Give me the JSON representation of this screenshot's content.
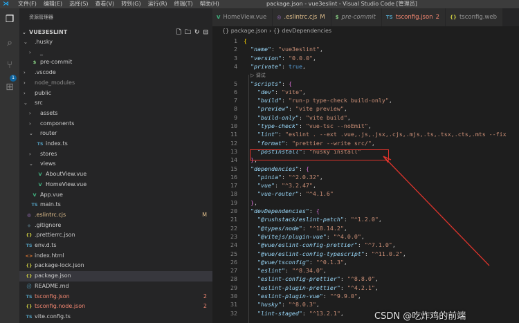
{
  "titlebar": {
    "menus": [
      "文件(F)",
      "编辑(E)",
      "选择(S)",
      "查看(V)",
      "转到(G)",
      "运行(R)",
      "终端(T)",
      "帮助(H)"
    ],
    "window_title": "package.json - vue3eslint - Visual Studio Code [管理员]"
  },
  "activity": {
    "scm_badge": "1"
  },
  "sidebar": {
    "title": "资源管理器",
    "folder": "VUE3ESLINT",
    "rows": [
      {
        "name": ".husky",
        "depth": 1,
        "kind": "folder",
        "open": true
      },
      {
        "name": "_",
        "depth": 2,
        "kind": "folder",
        "open": false
      },
      {
        "name": "pre-commit",
        "depth": 2,
        "kind": "file",
        "icon": "$",
        "iconColor": "#89d185"
      },
      {
        "name": ".vscode",
        "depth": 1,
        "kind": "folder",
        "open": false
      },
      {
        "name": "node_modules",
        "depth": 1,
        "kind": "folder",
        "open": false,
        "dim": true
      },
      {
        "name": "public",
        "depth": 1,
        "kind": "folder",
        "open": false
      },
      {
        "name": "src",
        "depth": 1,
        "kind": "folder",
        "open": true
      },
      {
        "name": "assets",
        "depth": 2,
        "kind": "folder",
        "open": false
      },
      {
        "name": "components",
        "depth": 2,
        "kind": "folder",
        "open": false
      },
      {
        "name": "router",
        "depth": 2,
        "kind": "folder",
        "open": true
      },
      {
        "name": "index.ts",
        "depth": 3,
        "kind": "file",
        "icon": "TS",
        "iconColor": "#519aba"
      },
      {
        "name": "stores",
        "depth": 2,
        "kind": "folder",
        "open": false
      },
      {
        "name": "views",
        "depth": 2,
        "kind": "folder",
        "open": true
      },
      {
        "name": "AboutView.vue",
        "depth": 3,
        "kind": "file",
        "icon": "V",
        "iconColor": "#41b883"
      },
      {
        "name": "HomeView.vue",
        "depth": 3,
        "kind": "file",
        "icon": "V",
        "iconColor": "#41b883"
      },
      {
        "name": "App.vue",
        "depth": 2,
        "kind": "file",
        "icon": "V",
        "iconColor": "#41b883"
      },
      {
        "name": "main.ts",
        "depth": 2,
        "kind": "file",
        "icon": "TS",
        "iconColor": "#519aba"
      },
      {
        "name": ".eslintrc.cjs",
        "depth": 1,
        "kind": "file",
        "icon": "◎",
        "iconColor": "#a074c4",
        "badge": "M",
        "color": "#e2c08d"
      },
      {
        "name": ".gitignore",
        "depth": 1,
        "kind": "file",
        "icon": "◆",
        "iconColor": "#41535b"
      },
      {
        "name": ".prettierrc.json",
        "depth": 1,
        "kind": "file",
        "icon": "{}",
        "iconColor": "#cbcb41"
      },
      {
        "name": "env.d.ts",
        "depth": 1,
        "kind": "file",
        "icon": "TS",
        "iconColor": "#519aba"
      },
      {
        "name": "index.html",
        "depth": 1,
        "kind": "file",
        "icon": "<>",
        "iconColor": "#e37933"
      },
      {
        "name": "package-lock.json",
        "depth": 1,
        "kind": "file",
        "icon": "{}",
        "iconColor": "#cbcb41"
      },
      {
        "name": "package.json",
        "depth": 1,
        "kind": "file",
        "icon": "{}",
        "iconColor": "#cbcb41",
        "selected": true
      },
      {
        "name": "README.md",
        "depth": 1,
        "kind": "file",
        "icon": "ⓘ",
        "iconColor": "#519aba"
      },
      {
        "name": "tsconfig.json",
        "depth": 1,
        "kind": "file",
        "icon": "TS",
        "iconColor": "#519aba",
        "badge": "2",
        "color": "#f48771"
      },
      {
        "name": "tsconfig.node.json",
        "depth": 1,
        "kind": "file",
        "icon": "{}",
        "iconColor": "#cbcb41",
        "badge": "2",
        "color": "#f48771"
      },
      {
        "name": "vite.config.ts",
        "depth": 1,
        "kind": "file",
        "icon": "TS",
        "iconColor": "#519aba"
      }
    ]
  },
  "tabs": [
    {
      "label": "HomeView.vue",
      "icon": "V",
      "iconColor": "#41b883",
      "color": "#969696"
    },
    {
      "label": ".eslintrc.cjs",
      "icon": "◎",
      "iconColor": "#a074c4",
      "suffix": "M",
      "color": "#e2c08d"
    },
    {
      "label": "pre-commit",
      "icon": "$",
      "iconColor": "#89d185",
      "color": "#969696",
      "italic": true
    },
    {
      "label": "tsconfig.json",
      "icon": "TS",
      "iconColor": "#519aba",
      "suffix": "2",
      "color": "#f48771"
    },
    {
      "label": "tsconfig.web",
      "icon": "{}",
      "iconColor": "#cbcb41",
      "color": "#969696"
    }
  ],
  "breadcrumb": [
    "{} package.json",
    "{} devDependencies"
  ],
  "code": [
    {
      "n": "1",
      "t": [
        [
          "br",
          "{"
        ]
      ]
    },
    {
      "n": "2",
      "t": [
        [
          "",
          "  "
        ],
        [
          "k",
          "\"name\""
        ],
        [
          "",
          ": "
        ],
        [
          "s",
          "\"vue3eslint\""
        ],
        [
          "",
          ","
        ]
      ]
    },
    {
      "n": "3",
      "t": [
        [
          "",
          "  "
        ],
        [
          "k",
          "\"version\""
        ],
        [
          "",
          ": "
        ],
        [
          "s",
          "\"0.0.0\""
        ],
        [
          "",
          ","
        ]
      ]
    },
    {
      "n": "4",
      "t": [
        [
          "",
          "  "
        ],
        [
          "k",
          "\"private\""
        ],
        [
          "",
          ": "
        ],
        [
          "b",
          "true"
        ],
        [
          "",
          ","
        ]
      ]
    },
    {
      "n": "",
      "lens": "▷ 调试"
    },
    {
      "n": "5",
      "t": [
        [
          "",
          "  "
        ],
        [
          "k",
          "\"scripts\""
        ],
        [
          "",
          ": "
        ],
        [
          "br2",
          "{"
        ]
      ]
    },
    {
      "n": "6",
      "t": [
        [
          "",
          "    "
        ],
        [
          "k",
          "\"dev\""
        ],
        [
          "",
          ": "
        ],
        [
          "s",
          "\"vite\""
        ],
        [
          "",
          ","
        ]
      ]
    },
    {
      "n": "7",
      "t": [
        [
          "",
          "    "
        ],
        [
          "k",
          "\"build\""
        ],
        [
          "",
          ": "
        ],
        [
          "s",
          "\"run-p type-check build-only\""
        ],
        [
          "",
          ","
        ]
      ]
    },
    {
      "n": "8",
      "t": [
        [
          "",
          "    "
        ],
        [
          "k",
          "\"preview\""
        ],
        [
          "",
          ": "
        ],
        [
          "s",
          "\"vite preview\""
        ],
        [
          "",
          ","
        ]
      ]
    },
    {
      "n": "9",
      "t": [
        [
          "",
          "    "
        ],
        [
          "k",
          "\"build-only\""
        ],
        [
          "",
          ": "
        ],
        [
          "s",
          "\"vite build\""
        ],
        [
          "",
          ","
        ]
      ]
    },
    {
      "n": "10",
      "t": [
        [
          "",
          "    "
        ],
        [
          "k",
          "\"type-check\""
        ],
        [
          "",
          ": "
        ],
        [
          "s",
          "\"vue-tsc --noEmit\""
        ],
        [
          "",
          ","
        ]
      ]
    },
    {
      "n": "11",
      "t": [
        [
          "",
          "    "
        ],
        [
          "k",
          "\"lint\""
        ],
        [
          "",
          ": "
        ],
        [
          "s",
          "\"eslint . --ext .vue,.js,.jsx,.cjs,.mjs,.ts,.tsx,.cts,.mts --fix"
        ]
      ]
    },
    {
      "n": "12",
      "t": [
        [
          "",
          "    "
        ],
        [
          "k",
          "\"format\""
        ],
        [
          "",
          ": "
        ],
        [
          "s",
          "\"prettier --write src/\""
        ],
        [
          "",
          ","
        ]
      ]
    },
    {
      "n": "13",
      "t": [
        [
          "",
          "    "
        ],
        [
          "k",
          "\"postinstall\""
        ],
        [
          "",
          ": "
        ],
        [
          "s",
          "\"husky install\""
        ]
      ]
    },
    {
      "n": "14",
      "t": [
        [
          "",
          "  "
        ],
        [
          "br2",
          "}"
        ],
        [
          "",
          ","
        ]
      ]
    },
    {
      "n": "15",
      "t": [
        [
          "",
          "  "
        ],
        [
          "k",
          "\"dependencies\""
        ],
        [
          "",
          ": "
        ],
        [
          "br2",
          "{"
        ]
      ]
    },
    {
      "n": "16",
      "t": [
        [
          "",
          "    "
        ],
        [
          "k",
          "\"pinia\""
        ],
        [
          "",
          ": "
        ],
        [
          "s",
          "\"^2.0.32\""
        ],
        [
          "",
          ","
        ]
      ]
    },
    {
      "n": "17",
      "t": [
        [
          "",
          "    "
        ],
        [
          "k",
          "\"vue\""
        ],
        [
          "",
          ": "
        ],
        [
          "s",
          "\"^3.2.47\""
        ],
        [
          "",
          ","
        ]
      ]
    },
    {
      "n": "18",
      "t": [
        [
          "",
          "    "
        ],
        [
          "k",
          "\"vue-router\""
        ],
        [
          "",
          ": "
        ],
        [
          "s",
          "\"^4.1.6\""
        ]
      ]
    },
    {
      "n": "19",
      "t": [
        [
          "",
          "  "
        ],
        [
          "br2",
          "}"
        ],
        [
          "",
          ","
        ]
      ]
    },
    {
      "n": "20",
      "t": [
        [
          "",
          "  "
        ],
        [
          "k",
          "\"devDependencies\""
        ],
        [
          "",
          ": "
        ],
        [
          "br2",
          "{"
        ]
      ]
    },
    {
      "n": "21",
      "t": [
        [
          "",
          "    "
        ],
        [
          "k",
          "\"@rushstack/eslint-patch\""
        ],
        [
          "",
          ": "
        ],
        [
          "s",
          "\"^1.2.0\""
        ],
        [
          "",
          ","
        ]
      ]
    },
    {
      "n": "22",
      "t": [
        [
          "",
          "    "
        ],
        [
          "k",
          "\"@types/node\""
        ],
        [
          "",
          ": "
        ],
        [
          "s",
          "\"^18.14.2\""
        ],
        [
          "",
          ","
        ]
      ]
    },
    {
      "n": "23",
      "t": [
        [
          "",
          "    "
        ],
        [
          "k",
          "\"@vitejs/plugin-vue\""
        ],
        [
          "",
          ": "
        ],
        [
          "s",
          "\"^4.0.0\""
        ],
        [
          "",
          ","
        ]
      ]
    },
    {
      "n": "24",
      "t": [
        [
          "",
          "    "
        ],
        [
          "k",
          "\"@vue/eslint-config-prettier\""
        ],
        [
          "",
          ": "
        ],
        [
          "s",
          "\"^7.1.0\""
        ],
        [
          "",
          ","
        ]
      ]
    },
    {
      "n": "25",
      "t": [
        [
          "",
          "    "
        ],
        [
          "k",
          "\"@vue/eslint-config-typescript\""
        ],
        [
          "",
          ": "
        ],
        [
          "s",
          "\"^11.0.2\""
        ],
        [
          "",
          ","
        ]
      ]
    },
    {
      "n": "26",
      "t": [
        [
          "",
          "    "
        ],
        [
          "k",
          "\"@vue/tsconfig\""
        ],
        [
          "",
          ": "
        ],
        [
          "s",
          "\"^0.1.3\""
        ],
        [
          "",
          ","
        ]
      ]
    },
    {
      "n": "27",
      "t": [
        [
          "",
          "    "
        ],
        [
          "k",
          "\"eslint\""
        ],
        [
          "",
          ": "
        ],
        [
          "s",
          "\"^8.34.0\""
        ],
        [
          "",
          ","
        ]
      ]
    },
    {
      "n": "28",
      "t": [
        [
          "",
          "    "
        ],
        [
          "k",
          "\"eslint-config-prettier\""
        ],
        [
          "",
          ": "
        ],
        [
          "s",
          "\"^8.8.0\""
        ],
        [
          "",
          ","
        ]
      ]
    },
    {
      "n": "29",
      "t": [
        [
          "",
          "    "
        ],
        [
          "k",
          "\"eslint-plugin-prettier\""
        ],
        [
          "",
          ": "
        ],
        [
          "s",
          "\"^4.2.1\""
        ],
        [
          "",
          ","
        ]
      ]
    },
    {
      "n": "30",
      "t": [
        [
          "",
          "    "
        ],
        [
          "k",
          "\"eslint-plugin-vue\""
        ],
        [
          "",
          ": "
        ],
        [
          "s",
          "\"^9.9.0\""
        ],
        [
          "",
          ","
        ]
      ]
    },
    {
      "n": "31",
      "t": [
        [
          "",
          "    "
        ],
        [
          "k",
          "\"husky\""
        ],
        [
          "",
          ": "
        ],
        [
          "s",
          "\"^8.0.3\""
        ],
        [
          "",
          ","
        ]
      ]
    },
    {
      "n": "32",
      "t": [
        [
          "",
          "    "
        ],
        [
          "k",
          "\"lint-staged\""
        ],
        [
          "",
          ": "
        ],
        [
          "s",
          "\"^13.2.1\""
        ],
        [
          "",
          ","
        ]
      ]
    }
  ],
  "watermark": "CSDN @吃炸鸡的前端",
  "colors": {
    "highlight_box": "#e0342c",
    "accent": "#0e639c"
  }
}
